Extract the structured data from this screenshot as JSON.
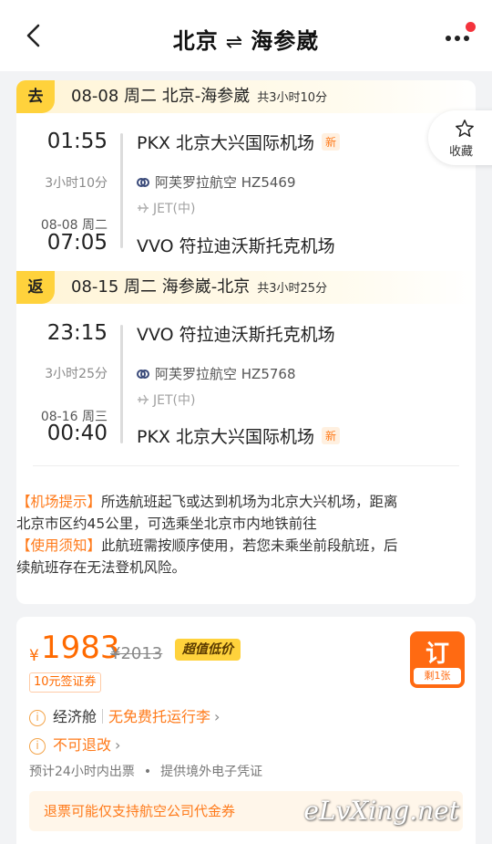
{
  "header": {
    "from_city": "北京",
    "arrow": "⇌",
    "to_city": "海参崴"
  },
  "favorite": {
    "label": "收藏"
  },
  "outbound": {
    "tag": "去",
    "title": "08-08 周二 北京-海参崴",
    "total_duration": "共3小时10分",
    "dep_time": "01:55",
    "dep_airport": "PKX 北京大兴国际机场",
    "dep_badge": "新",
    "duration": "3小时10分",
    "airline": "阿芙罗拉航空 HZ5469",
    "aircraft": "JET(中)",
    "arr_date": "08-08 周二",
    "arr_time": "07:05",
    "arr_airport": "VVO 符拉迪沃斯托克机场"
  },
  "return": {
    "tag": "返",
    "title": "08-15 周二 海参崴-北京",
    "total_duration": "共3小时25分",
    "dep_time": "23:15",
    "dep_airport": "VVO 符拉迪沃斯托克机场",
    "duration": "3小时25分",
    "airline": "阿芙罗拉航空 HZ5768",
    "aircraft": "JET(中)",
    "arr_date": "08-16 周三",
    "arr_time": "00:40",
    "arr_airport": "PKX 北京大兴国际机场",
    "arr_badge": "新"
  },
  "notices": {
    "airport_label": "【机场提示】",
    "airport_text_1": "所选航班起飞或达到机场为北京大兴机场，距离",
    "airport_text_2": "北京市区约45公里，可选乘坐北京市内地铁前往",
    "usage_label": "【使用须知】",
    "usage_text_1": "此航班需按顺序使用，若您未乘坐前段航班，后",
    "usage_text_2": "续航班存在无法登机风险。"
  },
  "offer": {
    "currency": "¥",
    "price": "1983",
    "old_price": "¥2013",
    "deal_label": "超值低价",
    "coupon": "10元签证券",
    "cabin": "经济舱",
    "baggage": "无免费托运行李",
    "refund_policy": "不可退改",
    "ticketing": "预计24小时内出票",
    "dot": "•",
    "voucher": "提供境外电子凭证",
    "refund_note": "退票可能仅支持航空公司代金券",
    "book_label": "订",
    "seats_left": "剩1张"
  },
  "watermark": "eLvXing.net",
  "colors": {
    "accent": "#ff6a00",
    "tag_yellow": "#ffd23c"
  }
}
